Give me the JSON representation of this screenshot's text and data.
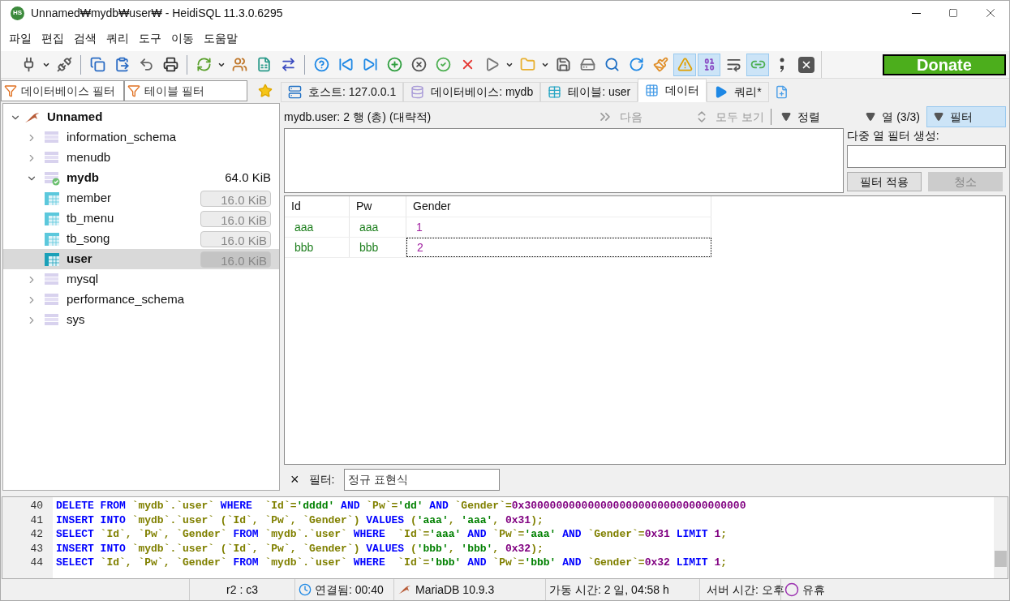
{
  "window": {
    "logo": "HS",
    "title": "Unnamed₩mydb₩user₩ - HeidiSQL 11.3.0.6295"
  },
  "menu": [
    "파일",
    "편집",
    "검색",
    "쿼리",
    "도구",
    "이동",
    "도움말"
  ],
  "toolbar": [
    {
      "kind": "plug",
      "pressed": false
    },
    {
      "kind": "caret",
      "pressed": false
    },
    {
      "kind": "unplug",
      "pressed": false
    },
    {
      "kind": "sep"
    },
    {
      "kind": "copy",
      "pressed": false
    },
    {
      "kind": "paste",
      "pressed": false
    },
    {
      "kind": "undo",
      "pressed": false
    },
    {
      "kind": "print",
      "pressed": false
    },
    {
      "kind": "sep"
    },
    {
      "kind": "refresh",
      "pressed": false
    },
    {
      "kind": "caret",
      "pressed": false
    },
    {
      "kind": "users",
      "pressed": false
    },
    {
      "kind": "csv",
      "pressed": false
    },
    {
      "kind": "transfer",
      "pressed": false
    },
    {
      "kind": "sep"
    },
    {
      "kind": "help",
      "pressed": false
    },
    {
      "kind": "first",
      "pressed": false
    },
    {
      "kind": "last",
      "pressed": false
    },
    {
      "kind": "add",
      "pressed": false
    },
    {
      "kind": "cancel",
      "pressed": false
    },
    {
      "kind": "post",
      "pressed": false
    },
    {
      "kind": "delete",
      "pressed": false
    },
    {
      "kind": "run",
      "pressed": false
    },
    {
      "kind": "caret",
      "pressed": false
    },
    {
      "kind": "folder",
      "pressed": false
    },
    {
      "kind": "caret",
      "pressed": false
    },
    {
      "kind": "save",
      "pressed": false
    },
    {
      "kind": "saveas",
      "pressed": false
    },
    {
      "kind": "find",
      "pressed": false
    },
    {
      "kind": "replace",
      "pressed": false
    },
    {
      "kind": "clean",
      "pressed": false
    },
    {
      "kind": "warning",
      "pressed": true
    },
    {
      "kind": "binary",
      "pressed": true
    },
    {
      "kind": "wrap",
      "pressed": false
    },
    {
      "kind": "sync",
      "pressed": true
    },
    {
      "kind": "semicolon",
      "pressed": false
    },
    {
      "kind": "close",
      "pressed": false
    }
  ],
  "donate": "Donate",
  "db_filter": {
    "placeholder": "데이터베이스 필터"
  },
  "table_filter": {
    "placeholder": "테이블 필터"
  },
  "tabs": [
    {
      "kind": "host",
      "label": "호스트: 127.0.0.1",
      "selected": false
    },
    {
      "kind": "database",
      "label": "데이터베이스: mydb",
      "selected": false
    },
    {
      "kind": "table",
      "label": "테이블: user",
      "selected": false
    },
    {
      "kind": "data",
      "label": "데이터",
      "selected": true
    },
    {
      "kind": "query",
      "label": "쿼리*",
      "selected": false
    }
  ],
  "tree": {
    "label": "Unnamed",
    "expanded": true,
    "children": [
      {
        "label": "information_schema",
        "expanded": false,
        "current": false
      },
      {
        "label": "menudb",
        "expanded": false,
        "current": false
      },
      {
        "label": "mydb",
        "expanded": true,
        "current": true,
        "size": "64.0 KiB",
        "children": [
          {
            "label": "member",
            "size": "16.0 KiB",
            "selected": false
          },
          {
            "label": "tb_menu",
            "size": "16.0 KiB",
            "selected": false
          },
          {
            "label": "tb_song",
            "size": "16.0 KiB",
            "selected": false
          },
          {
            "label": "user",
            "size": "16.0 KiB",
            "selected": true
          }
        ]
      },
      {
        "label": "mysql",
        "expanded": false,
        "current": false
      },
      {
        "label": "performance_schema",
        "expanded": false,
        "current": false
      },
      {
        "label": "sys",
        "expanded": false,
        "current": false
      }
    ]
  },
  "data": {
    "summary": "mydb.user: 2 행 (총) (대략적)",
    "actions": [
      {
        "kind": "next",
        "label": "다음",
        "disabled": true,
        "pressed": false
      },
      {
        "kind": "all",
        "label": "모두 보기",
        "disabled": true,
        "pressed": false
      },
      {
        "kind": "sort",
        "label": "정렬",
        "disabled": false,
        "pressed": false
      },
      {
        "kind": "columns",
        "label": "열 (3/3)",
        "disabled": false,
        "pressed": false
      },
      {
        "kind": "filter",
        "label": "필터",
        "disabled": false,
        "pressed": true
      }
    ],
    "multi_filter_label": "다중 열 필터 생성:",
    "apply_button": {
      "label": "필터 적용",
      "disabled": false
    },
    "clear_button": {
      "label": "청소",
      "disabled": true
    },
    "columns": [
      "Id",
      "Pw",
      "Gender"
    ],
    "rows": [
      {
        "cells": [
          "aaa",
          "aaa",
          "1"
        ],
        "focused_cell": false
      },
      {
        "cells": [
          "bbb",
          "bbb",
          "2"
        ],
        "focused_cell": true
      }
    ],
    "quick_filter": {
      "close": "×",
      "label": "필터:",
      "placeholder": "정규 표현식"
    }
  },
  "log": [
    {
      "number": "40",
      "tokens": [
        {
          "kind": "kw",
          "text": "DELETE FROM"
        },
        {
          "kind": "id",
          "text": " `mydb`.`user` "
        },
        {
          "kind": "kw",
          "text": "WHERE"
        },
        {
          "kind": "id",
          "text": "  `Id`="
        },
        {
          "kind": "str",
          "text": "'dddd'"
        },
        {
          "kind": "kw",
          "text": " AND "
        },
        {
          "kind": "id",
          "text": "`Pw`="
        },
        {
          "kind": "str",
          "text": "'dd'"
        },
        {
          "kind": "kw",
          "text": " AND "
        },
        {
          "kind": "id",
          "text": "`Gender`="
        },
        {
          "kind": "num",
          "text": "0x30000000000000000000000000000000000"
        }
      ]
    },
    {
      "number": "41",
      "tokens": [
        {
          "kind": "kw",
          "text": "INSERT INTO"
        },
        {
          "kind": "id",
          "text": " `mydb`.`user` (`Id`, `Pw`, `Gender`) "
        },
        {
          "kind": "kw",
          "text": "VALUES"
        },
        {
          "kind": "id",
          "text": " ("
        },
        {
          "kind": "str",
          "text": "'aaa'"
        },
        {
          "kind": "id",
          "text": ", "
        },
        {
          "kind": "str",
          "text": "'aaa'"
        },
        {
          "kind": "id",
          "text": ", "
        },
        {
          "kind": "num",
          "text": "0x31"
        },
        {
          "kind": "id",
          "text": ");"
        }
      ]
    },
    {
      "number": "42",
      "tokens": [
        {
          "kind": "kw",
          "text": "SELECT"
        },
        {
          "kind": "id",
          "text": " `Id`, `Pw`, `Gender` "
        },
        {
          "kind": "kw",
          "text": "FROM"
        },
        {
          "kind": "id",
          "text": " `mydb`.`user` "
        },
        {
          "kind": "kw",
          "text": "WHERE"
        },
        {
          "kind": "id",
          "text": "  `Id`="
        },
        {
          "kind": "str",
          "text": "'aaa'"
        },
        {
          "kind": "kw",
          "text": " AND "
        },
        {
          "kind": "id",
          "text": "`Pw`="
        },
        {
          "kind": "str",
          "text": "'aaa'"
        },
        {
          "kind": "kw",
          "text": " AND "
        },
        {
          "kind": "id",
          "text": "`Gender`="
        },
        {
          "kind": "num",
          "text": "0x31"
        },
        {
          "kind": "kw",
          "text": " LIMIT "
        },
        {
          "kind": "num",
          "text": "1"
        },
        {
          "kind": "id",
          "text": ";"
        }
      ]
    },
    {
      "number": "43",
      "tokens": [
        {
          "kind": "kw",
          "text": "INSERT INTO"
        },
        {
          "kind": "id",
          "text": " `mydb`.`user` (`Id`, `Pw`, `Gender`) "
        },
        {
          "kind": "kw",
          "text": "VALUES"
        },
        {
          "kind": "id",
          "text": " ("
        },
        {
          "kind": "str",
          "text": "'bbb'"
        },
        {
          "kind": "id",
          "text": ", "
        },
        {
          "kind": "str",
          "text": "'bbb'"
        },
        {
          "kind": "id",
          "text": ", "
        },
        {
          "kind": "num",
          "text": "0x32"
        },
        {
          "kind": "id",
          "text": ");"
        }
      ]
    },
    {
      "number": "44",
      "tokens": [
        {
          "kind": "kw",
          "text": "SELECT"
        },
        {
          "kind": "id",
          "text": " `Id`, `Pw`, `Gender` "
        },
        {
          "kind": "kw",
          "text": "FROM"
        },
        {
          "kind": "id",
          "text": " `mydb`.`user` "
        },
        {
          "kind": "kw",
          "text": "WHERE"
        },
        {
          "kind": "id",
          "text": "  `Id`="
        },
        {
          "kind": "str",
          "text": "'bbb'"
        },
        {
          "kind": "kw",
          "text": " AND "
        },
        {
          "kind": "id",
          "text": "`Pw`="
        },
        {
          "kind": "str",
          "text": "'bbb'"
        },
        {
          "kind": "kw",
          "text": " AND "
        },
        {
          "kind": "id",
          "text": "`Gender`="
        },
        {
          "kind": "num",
          "text": "0x32"
        },
        {
          "kind": "kw",
          "text": " LIMIT "
        },
        {
          "kind": "num",
          "text": "1"
        },
        {
          "kind": "id",
          "text": ";"
        }
      ]
    }
  ],
  "status_bar": [
    {
      "kind": "plain",
      "text": "r2 : c3"
    },
    {
      "kind": "clock",
      "text": "연결됨: 00:40"
    },
    {
      "kind": "server",
      "text": "MariaDB 10.9.3"
    },
    {
      "kind": "plain",
      "text": "가동 시간: 2 일, 04:58 h"
    },
    {
      "kind": "clock",
      "text": "서버 시간: 오후"
    },
    {
      "kind": "idle",
      "text": "유휴"
    }
  ]
}
